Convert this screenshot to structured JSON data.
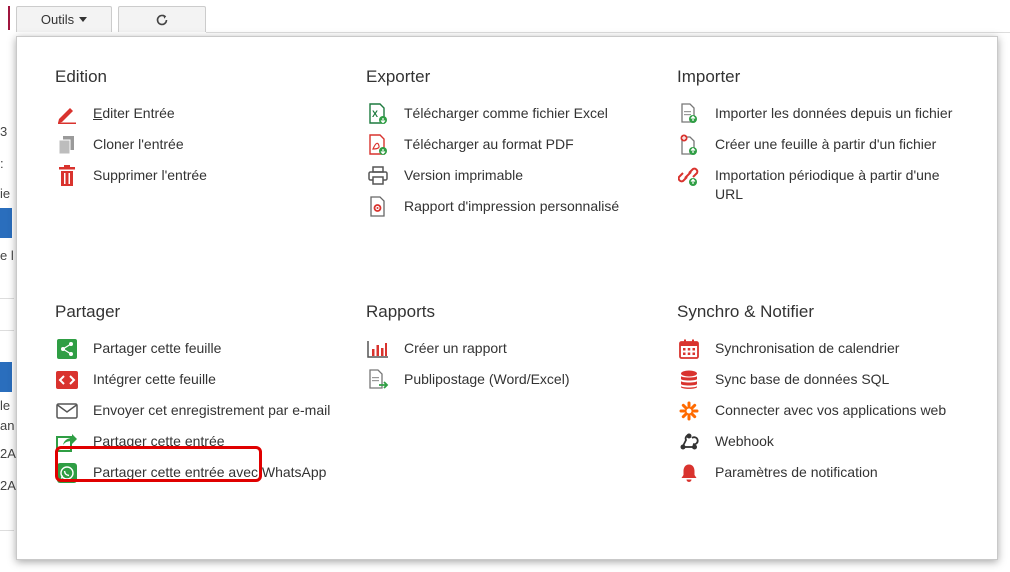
{
  "toolbar": {
    "tools_label": "Outils",
    "refresh_icon": "refresh-icon"
  },
  "background_fragments": [
    "3",
    ":",
    "ie",
    "e l",
    "le",
    "an",
    "2A",
    "2A"
  ],
  "sections": {
    "edition": {
      "title": "Edition",
      "items": [
        {
          "label_first": "E",
          "label_rest": "diter Entrée",
          "icon": "pencil-icon"
        },
        {
          "label": "Cloner l'entrée",
          "icon": "copy-icon"
        },
        {
          "label": "Supprimer l'entrée",
          "icon": "trash-icon"
        }
      ]
    },
    "exporter": {
      "title": "Exporter",
      "items": [
        {
          "label": "Télécharger comme fichier Excel",
          "icon": "excel-file-icon"
        },
        {
          "label": "Télécharger au format PDF",
          "icon": "pdf-file-icon"
        },
        {
          "label": "Version imprimable",
          "icon": "printer-icon"
        },
        {
          "label": "Rapport d'impression personnalisé",
          "icon": "custom-print-icon"
        }
      ]
    },
    "importer": {
      "title": "Importer",
      "items": [
        {
          "label": "Importer les données depuis un fichier",
          "icon": "import-file-icon"
        },
        {
          "label": "Créer une feuille à partir d'un fichier",
          "icon": "create-sheet-icon"
        },
        {
          "label": "Importation périodique à partir d'une URL",
          "icon": "link-import-icon"
        }
      ]
    },
    "partager": {
      "title": "Partager",
      "items": [
        {
          "label": "Partager cette feuille",
          "icon": "share-icon"
        },
        {
          "label": "Intégrer cette feuille",
          "icon": "embed-icon"
        },
        {
          "label": "Envoyer cet enregistrement par e-mail",
          "icon": "envelope-icon"
        },
        {
          "label": "Partager cette entrée",
          "icon": "share-entry-icon"
        },
        {
          "label": "Partager cette entrée avec WhatsApp",
          "icon": "whatsapp-icon"
        }
      ]
    },
    "rapports": {
      "title": "Rapports",
      "items": [
        {
          "label": "Créer un rapport",
          "icon": "bar-chart-icon"
        },
        {
          "label": "Publipostage (Word/Excel)",
          "icon": "mail-merge-icon"
        }
      ]
    },
    "synchro": {
      "title": "Synchro & Notifier",
      "items": [
        {
          "label": "Synchronisation de calendrier",
          "icon": "calendar-icon"
        },
        {
          "label": "Sync base de données SQL",
          "icon": "database-icon"
        },
        {
          "label": "Connecter avec vos applications web",
          "icon": "zapier-icon"
        },
        {
          "label": "Webhook",
          "icon": "webhook-icon"
        },
        {
          "label": "Paramètres de notification",
          "icon": "bell-icon"
        }
      ]
    }
  },
  "colors": {
    "red": "#d9332e",
    "green": "#2f9e44",
    "excel_green": "#1d7a3e",
    "highlight": "#e00000",
    "gray": "#8a8a8a",
    "orange": "#ff6a00"
  }
}
